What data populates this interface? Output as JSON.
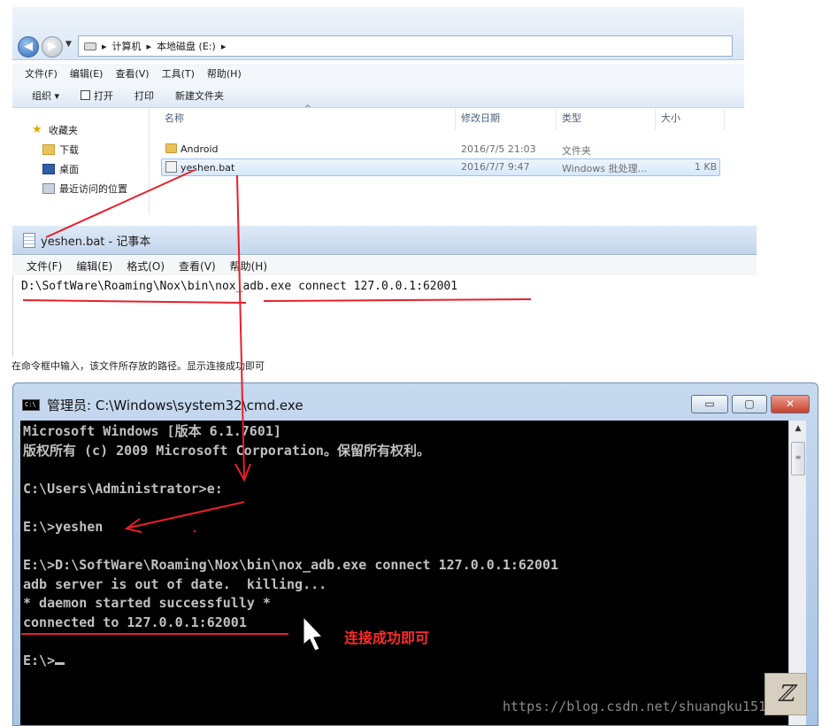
{
  "explorer": {
    "address": {
      "path_parts": [
        "计算机",
        "本地磁盘 (E:)"
      ]
    },
    "menu": [
      "文件(F)",
      "编辑(E)",
      "查看(V)",
      "工具(T)",
      "帮助(H)"
    ],
    "commands": {
      "organize": "组织 ▾",
      "open": "打开",
      "print": "打印",
      "new_folder": "新建文件夹"
    },
    "nav": {
      "favorites": "收藏夹",
      "downloads": "下载",
      "desktop": "桌面",
      "recent": "最近访问的位置"
    },
    "columns": {
      "name": "名称",
      "date": "修改日期",
      "type": "类型",
      "size": "大小"
    },
    "files": [
      {
        "name": "Android",
        "date": "2016/7/5 21:03",
        "type": "文件夹",
        "size": ""
      },
      {
        "name": "yeshen.bat",
        "date": "2016/7/7 9:47",
        "type": "Windows 批处理...",
        "size": "1 KB"
      }
    ]
  },
  "notepad": {
    "title": "yeshen.bat - 记事本",
    "menu": [
      "文件(F)",
      "编辑(E)",
      "格式(O)",
      "查看(V)",
      "帮助(H)"
    ],
    "content": "D:\\SoftWare\\Roaming\\Nox\\bin\\nox_adb.exe connect 127.0.0.1:62001"
  },
  "caption": "在命令框中输入，该文件所存放的路径。显示连接成功即可",
  "cmd": {
    "title": "管理员: C:\\Windows\\system32\\cmd.exe",
    "icon_text": "C:\\",
    "buttons": {
      "minimize": "▭",
      "maximize": "▢",
      "close": "✕"
    },
    "lines": [
      "Microsoft Windows [版本 6.1.7601]",
      "版权所有 (c) 2009 Microsoft Corporation。保留所有权利。",
      "",
      "C:\\Users\\Administrator>e:",
      "",
      "E:\\>yeshen",
      "",
      "E:\\>D:\\SoftWare\\Roaming\\Nox\\bin\\nox_adb.exe connect 127.0.0.1:62001",
      "adb server is out of date.  killing...",
      "* daemon started successfully *",
      "connected to 127.0.0.1:62001",
      "",
      "E:\\>"
    ]
  },
  "annotation": {
    "success_note": "连接成功即可"
  },
  "watermark": "https://blog.csdn.net/shuangku151",
  "colors": {
    "annotation_red": "#e8202a",
    "console_bg": "#000000",
    "console_fg": "#c0c0c0"
  }
}
